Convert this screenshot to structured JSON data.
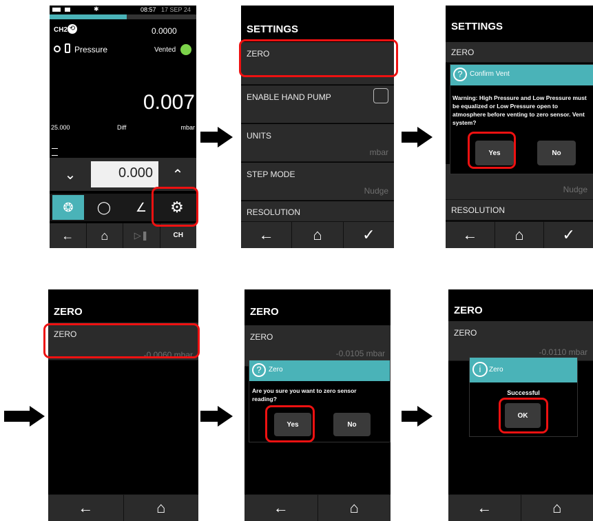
{
  "screen1": {
    "status": {
      "bluetooth": "✱",
      "time": "08:57",
      "date": "17 SEP 24"
    },
    "channel": {
      "label": "CH2",
      "value": "0.0000"
    },
    "function": {
      "label": "Pressure",
      "mode": "Vented"
    },
    "reading": {
      "value": "0.007"
    },
    "info": {
      "range": "25.000",
      "type": "Diff",
      "unit": "mbar"
    },
    "setpoint": {
      "value": "0.000"
    },
    "footer": {
      "ch_label": "CH"
    }
  },
  "screen2": {
    "title": "SETTINGS",
    "rows": [
      {
        "label": "ZERO",
        "value": ""
      },
      {
        "label": "ENABLE HAND PUMP",
        "value": ""
      },
      {
        "label": "UNITS",
        "value": "mbar"
      },
      {
        "label": "STEP MODE",
        "value": "Nudge"
      },
      {
        "label": "RESOLUTION",
        "value": ""
      }
    ]
  },
  "screen3": {
    "title": "SETTINGS",
    "zero_label": "ZERO",
    "step_mode_partial": "STEP MODE",
    "step_mode_value": "Nudge",
    "resolution_label": "RESOLUTION",
    "dialog": {
      "title": "Confirm Vent",
      "message": "Warning: High Pressure and Low Pressure must be equalized or Low Pressure open to atmosphere before venting to zero sensor. Vent system?",
      "yes": "Yes",
      "no": "No"
    }
  },
  "screen4": {
    "title": "ZERO",
    "row_label": "ZERO",
    "row_value": "-0.0060 mbar"
  },
  "screen5": {
    "title": "ZERO",
    "row_label": "ZERO",
    "row_value": "-0.0105 mbar",
    "dialog": {
      "title": "Zero",
      "message": "Are you sure you want to zero sensor reading?",
      "yes": "Yes",
      "no": "No"
    }
  },
  "screen6": {
    "title": "ZERO",
    "row_label": "ZERO",
    "row_value": "-0.0110 mbar",
    "dialog": {
      "title": "Zero",
      "message": "Successful",
      "ok": "OK"
    }
  },
  "colors": {
    "accent": "#4ab3b8",
    "highlight": "#e11111",
    "panel": "#2b2b2b",
    "background": "#000000"
  }
}
